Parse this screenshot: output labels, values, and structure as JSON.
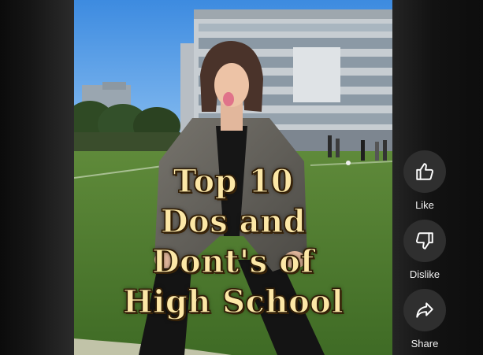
{
  "video": {
    "overlay_lines": [
      "Top 10",
      "Dos and",
      "Dont's of",
      "High School"
    ]
  },
  "actions": {
    "like": {
      "label": "Like",
      "icon": "thumbs-up-icon"
    },
    "dislike": {
      "label": "Dislike",
      "icon": "thumbs-down-icon"
    },
    "share": {
      "label": "Share",
      "icon": "share-arrow-icon"
    }
  },
  "colors": {
    "background": "#0f0f0f",
    "button_bg": "#2f2f2f",
    "label_text": "#f1f1f1",
    "overlay_text": "#fce7a6",
    "overlay_outline": "#2b1a06"
  }
}
